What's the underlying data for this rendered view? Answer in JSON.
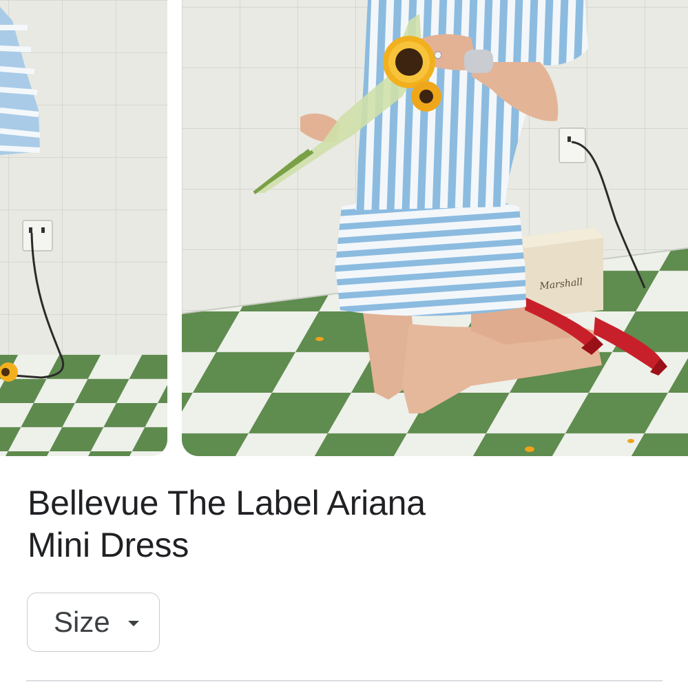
{
  "product": {
    "title_line1": "Bellevue The Label Ariana",
    "title_line2": "Mini Dress"
  },
  "size_selector": {
    "label": "Size",
    "icon": "caret-down-icon"
  },
  "gallery": {
    "images": [
      {
        "description_icon": "product-photo"
      },
      {
        "description_icon": "product-photo"
      }
    ]
  },
  "colors": {
    "tile_green": "#5e8a4e",
    "tile_white": "#eef0ea",
    "wall": "#e9ebe4",
    "dress_blue": "#8cbbe0",
    "sandal_red": "#c8202a"
  }
}
